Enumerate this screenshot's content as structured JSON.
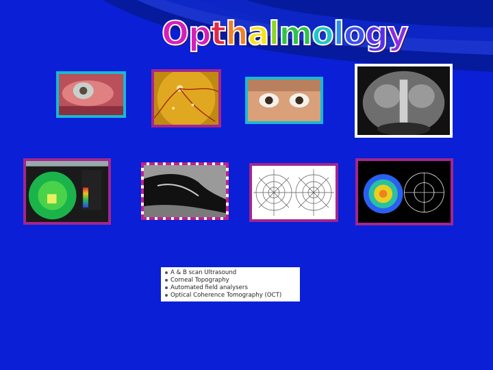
{
  "slide": {
    "title_letters": [
      {
        "ch": "O",
        "color": "#d61fb8"
      },
      {
        "ch": "p",
        "color": "#d61fb8"
      },
      {
        "ch": "t",
        "color": "#e02a48"
      },
      {
        "ch": "h",
        "color": "#f0802a"
      },
      {
        "ch": "a",
        "color": "#f7e21a"
      },
      {
        "ch": "l",
        "color": "#8bd42a"
      },
      {
        "ch": "m",
        "color": "#2ec24a"
      },
      {
        "ch": "o",
        "color": "#1ec6c8"
      },
      {
        "ch": "l",
        "color": "#2b8ff0"
      },
      {
        "ch": "o",
        "color": "#3a4ff0"
      },
      {
        "ch": "g",
        "color": "#5a2ee8"
      },
      {
        "ch": "y",
        "color": "#8a2ee0"
      }
    ],
    "bullets": [
      "A & B scan Ultrasound",
      "Corneal Topography",
      "Automated field analysers",
      "Optical Coherence Tomography (OCT)"
    ],
    "images": [
      {
        "name": "red-eye-photo",
        "frame": "#19b9d3"
      },
      {
        "name": "fundus-photo",
        "frame": "#a3268e"
      },
      {
        "name": "proptosis-eyes-photo",
        "frame": "#19b9d3"
      },
      {
        "name": "orbit-ct-scan",
        "frame": "#ffffff"
      },
      {
        "name": "corneal-topography-map",
        "frame": "#a3268e"
      },
      {
        "name": "b-scan-ultrasound",
        "frame": "checker"
      },
      {
        "name": "visual-field-chart",
        "frame": "#a3268e"
      },
      {
        "name": "oct-thickness-map",
        "frame": "#a3268e"
      }
    ],
    "colors": {
      "background": "#0a1fd6",
      "swoosh_dark": "#061a9e",
      "swoosh_light": "#2444ee"
    }
  }
}
